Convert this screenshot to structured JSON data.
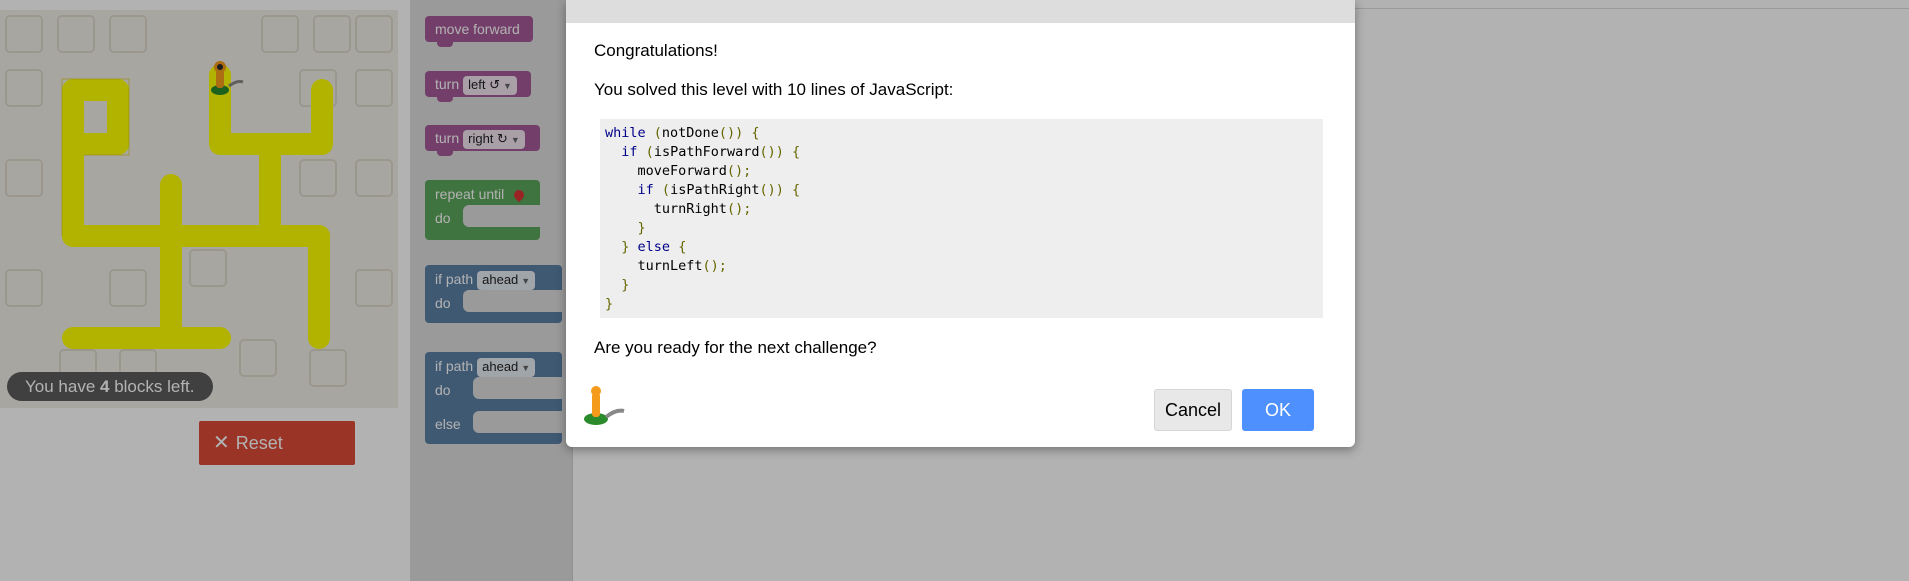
{
  "game": {
    "blocks_left_prefix": "You have ",
    "blocks_left_count": "4",
    "blocks_left_suffix": " blocks left.",
    "reset_label": "Reset",
    "reset_icon": "close-x-icon"
  },
  "toolbox": {
    "move_forward": "move forward",
    "turn_label": "turn",
    "turn_left_option": "left ↺",
    "turn_right_option": "right ↻",
    "repeat_until": "repeat until",
    "repeat_until_icon": "goal-marker-icon",
    "do_label": "do",
    "if_path": "if path",
    "ahead_option": "ahead",
    "else_label": "else"
  },
  "dialog": {
    "congrats": "Congratulations!",
    "solved_message": "You solved this level with 10 lines of JavaScript:",
    "code_lines": [
      "while (notDone()) {",
      "  if (isPathForward()) {",
      "    moveForward();",
      "    if (isPathRight()) {",
      "      turnRight();",
      "    }",
      "  } else {",
      "    turnLeft();",
      "  }",
      "}"
    ],
    "question": "Are you ready for the next challenge?",
    "cancel_label": "Cancel",
    "ok_label": "OK",
    "avatar_icon": "pegman-icon"
  },
  "colors": {
    "path": "#ffff00",
    "reset": "#dd4b39",
    "ok": "#4d90fe",
    "movement_blocks": "#a55b99",
    "loop_blocks": "#5ba55b",
    "logic_blocks": "#5b80a5"
  }
}
